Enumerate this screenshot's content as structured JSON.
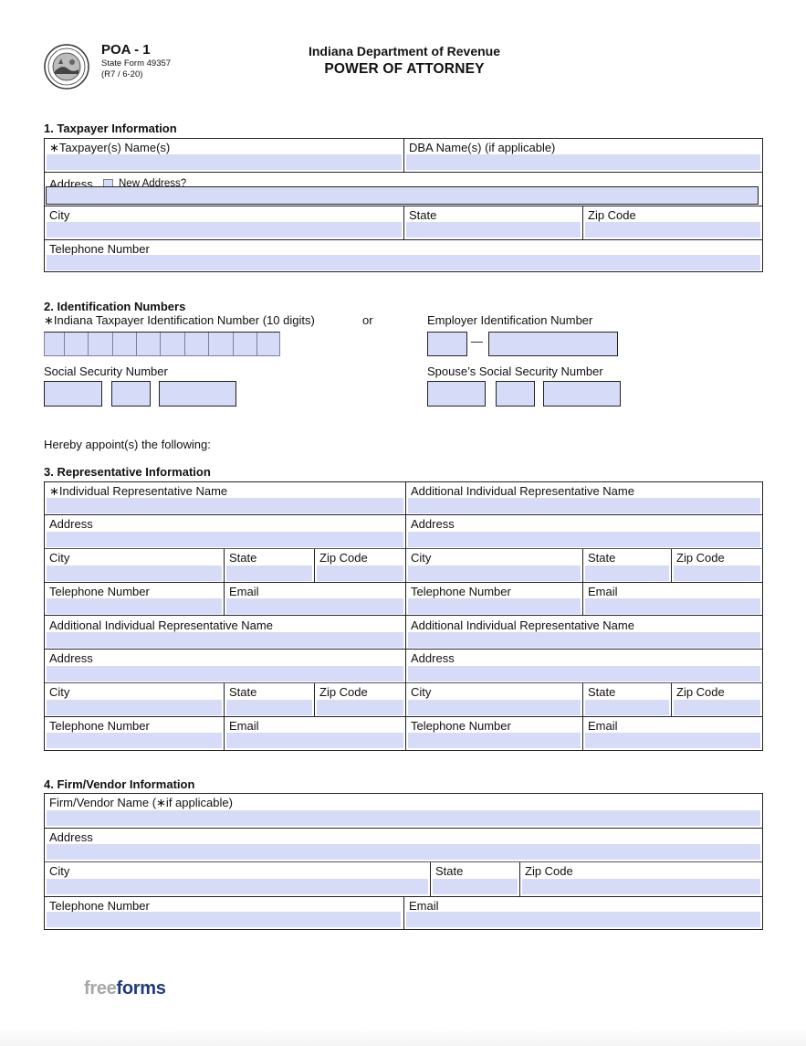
{
  "header": {
    "seal_icon": "state-seal-of-indiana",
    "form_id": "POA - 1",
    "state_form": "State Form 49357",
    "revision": "(R7 / 6-20)",
    "department": "Indiana Department of Revenue",
    "title": "POWER OF ATTORNEY"
  },
  "colors": {
    "field_fill": "#d6dcf7",
    "border": "#222222",
    "brand_grey": "#a7a7a7",
    "brand_blue": "#1f3b7d"
  },
  "section1": {
    "title": "1. Taxpayer Information",
    "taxpayer_name": "∗Taxpayer(s) Name(s)",
    "dba_name": "DBA Name(s) (if applicable)",
    "address": "Address",
    "new_address": "New Address?",
    "new_address_checked": false,
    "city": "City",
    "state": "State",
    "zip": "Zip Code",
    "telephone": "Telephone Number",
    "values": {
      "taxpayer_name": "",
      "dba_name": "",
      "address": "",
      "city": "",
      "state": "",
      "zip": "",
      "telephone": ""
    }
  },
  "section2": {
    "title": "2. Identification Numbers",
    "itin_label": "∗Indiana Taxpayer Identification Number (10 digits)",
    "or": "or",
    "ein_label": "Employer Identification Number",
    "ein_dash": "—",
    "ssn_label": "Social Security Number",
    "spouse_ssn_label": "Spouse’s Social Security Number",
    "itin_digits": [
      "",
      "",
      "",
      "",
      "",
      "",
      "",
      "",
      "",
      ""
    ],
    "ein": [
      "",
      ""
    ],
    "ssn": [
      "",
      "",
      ""
    ],
    "spouse_ssn": [
      "",
      "",
      ""
    ]
  },
  "appoint_text": "Hereby appoint(s) the following:",
  "section3": {
    "title": "3. Representative Information",
    "blocks": [
      {
        "name": "∗Individual Representative Name",
        "address": "Address",
        "city": "City",
        "state": "State",
        "zip": "Zip Code",
        "telephone": "Telephone Number",
        "email": "Email"
      },
      {
        "name": "Additional Individual Representative Name",
        "address": "Address",
        "city": "City",
        "state": "State",
        "zip": "Zip Code",
        "telephone": "Telephone Number",
        "email": "Email"
      },
      {
        "name": "Additional Individual Representative Name",
        "address": "Address",
        "city": "City",
        "state": "State",
        "zip": "Zip Code",
        "telephone": "Telephone Number",
        "email": "Email"
      },
      {
        "name": "Additional Individual Representative Name",
        "address": "Address",
        "city": "City",
        "state": "State",
        "zip": "Zip Code",
        "telephone": "Telephone Number",
        "email": "Email"
      }
    ]
  },
  "section4": {
    "title": "4. Firm/Vendor Information",
    "name": "Firm/Vendor Name (∗if applicable)",
    "address": "Address",
    "city": "City",
    "state": "State",
    "zip": "Zip Code",
    "telephone": "Telephone Number",
    "email": "Email"
  },
  "footer": {
    "brand_part1": "free",
    "brand_part2": "forms"
  }
}
